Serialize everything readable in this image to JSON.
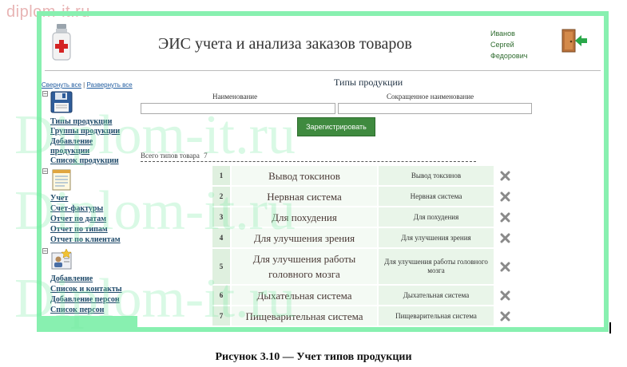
{
  "watermark": {
    "site": "diplom-it.ru",
    "big": "Diplom-it.ru"
  },
  "header": {
    "title": "ЭИС учета и анализа заказов товаров",
    "user": [
      "Иванов",
      "Сергей",
      "Федорович"
    ]
  },
  "sidebar": {
    "collapse_all": "Свернуть все",
    "separator": "|",
    "expand_all": "Развернуть все",
    "sections": [
      {
        "icon": "floppy-disk-icon",
        "links": [
          "Типы продукции",
          "Группы продукции",
          "Добавление продукции",
          "Список продукции"
        ]
      },
      {
        "icon": "notepad-icon",
        "links": [
          "Учет",
          "Счет-фактуры",
          "Отчет по датам",
          "Отчет по типам",
          "Отчет по клиентам"
        ]
      },
      {
        "icon": "person-card-icon",
        "links": [
          "Добавление",
          "Список и контакты",
          "Добавление персон",
          "Список персон"
        ]
      }
    ]
  },
  "main": {
    "title": "Типы продукции",
    "name_label": "Наименование",
    "short_label": "Сокращенное наименование",
    "name_value": "",
    "short_value": "",
    "register_button": "Зарегистрировать",
    "total_label": "Всего типов товара",
    "total_count": "7",
    "rows": [
      {
        "num": "1",
        "name": "Вывод токсинов",
        "short": "Вывод токсинов"
      },
      {
        "num": "2",
        "name": "Нервная система",
        "short": "Нервная система"
      },
      {
        "num": "3",
        "name": "Для похудения",
        "short": "Для похудения"
      },
      {
        "num": "4",
        "name": "Для улучшения зрения",
        "short": "Для улучшения зрения"
      },
      {
        "num": "5",
        "name": "Для улучшения работы головного мозга",
        "short": "Для улучшения работы головного мозга"
      },
      {
        "num": "6",
        "name": "Дыхательная система",
        "short": "Дыхательная система"
      },
      {
        "num": "7",
        "name": "Пищеварительная система",
        "short": "Пищеварительная система"
      }
    ]
  },
  "caption": "Рисунок 3.10  — Учет типов продукции",
  "colors": {
    "accent": "#3f8a3f",
    "frame": "#88f0b0",
    "link": "#1e5a9e",
    "row_bg": "#e6f2e6",
    "delete": "#8a8a8a"
  }
}
